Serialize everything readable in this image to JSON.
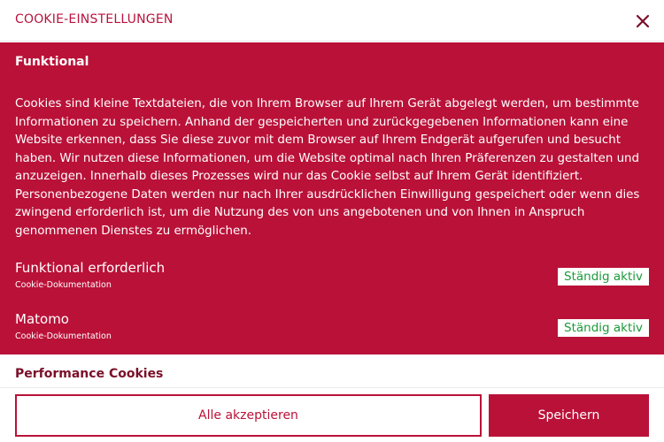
{
  "header": {
    "title": "COOKIE-EINSTELLUNGEN",
    "close_icon": "close-icon"
  },
  "functional": {
    "title": "Funktional",
    "description": "Cookies sind kleine Textdateien, die von Ihrem Browser auf Ihrem Gerät abgelegt werden, um bestimmte Informationen zu speichern. Anhand der gespeicherten und zurückgegebenen Informationen kann eine Website erkennen, dass Sie diese zuvor mit dem Browser auf Ihrem Endgerät aufgerufen und besucht haben. Wir nutzen diese Informationen, um die Website optimal nach Ihren Präferenzen zu gestalten und anzuzeigen. Innerhalb dieses Prozesses wird nur das Cookie selbst auf Ihrem Gerät identifiziert. Personenbezogene Daten werden nur nach Ihrer ausdrücklichen Einwilligung gespeichert oder wenn dies zwingend erforderlich ist, um die Nutzung des von uns angebotenen und von Ihnen in Anspruch genommenen Dienstes zu ermöglichen.",
    "items": [
      {
        "name": "Funktional erforderlich",
        "doc_link": "Cookie-Dokumentation",
        "status": "Ständig aktiv"
      },
      {
        "name": "Matomo",
        "doc_link": "Cookie-Dokumentation",
        "status": "Ständig aktiv"
      }
    ]
  },
  "performance": {
    "title": "Performance Cookies"
  },
  "footer": {
    "accept_all_label": "Alle akzeptieren",
    "save_label": "Speichern"
  },
  "colors": {
    "brand": "#ba1138",
    "status_text": "#1c9a3a",
    "background": "#ffffff"
  }
}
